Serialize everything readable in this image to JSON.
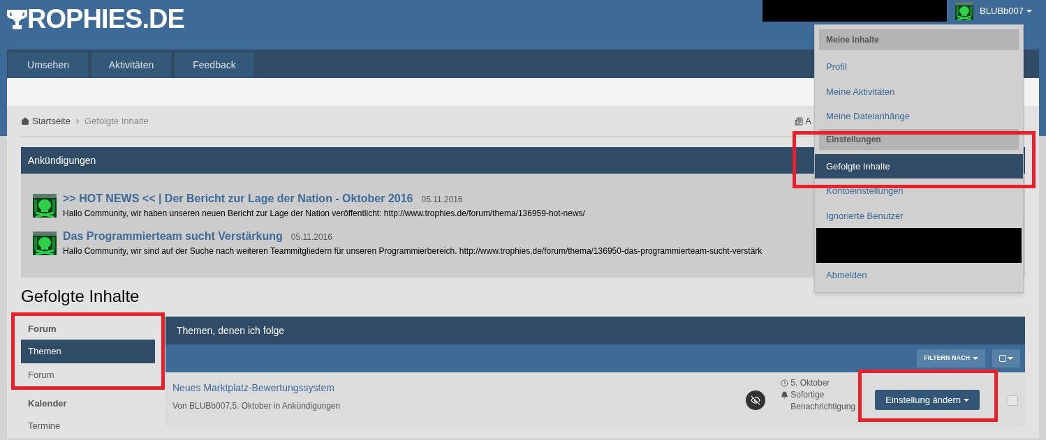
{
  "header": {
    "logo": "ROPHIES.DE",
    "user": {
      "name": "BLUBb007"
    }
  },
  "nav": {
    "tabs": [
      {
        "label": "Umsehen"
      },
      {
        "label": "Aktivitäten"
      },
      {
        "label": "Feedback"
      }
    ]
  },
  "breadcrumb": {
    "items": [
      "Startseite",
      "Gefolgte Inhalte"
    ],
    "side_link": "A"
  },
  "announcements": {
    "title": "Ankündigungen",
    "items": [
      {
        "title": ">> HOT NEWS << | Der Bericht zur Lage der Nation - Oktober 2016",
        "date": "05.11.2016",
        "text": "Hallo Community, wir haben unseren neuen Bericht zur Lage der Nation veröffentlicht: http://www.trophies.de/forum/thema/136959-hot-news/"
      },
      {
        "title": "Das Programmierteam sucht Verstärkung",
        "date": "05.11.2016",
        "text": "Hallo Community, wir sind auf der Suche nach weiteren Teammitgliedern für unseren Programmierbereich. http://www.trophies.de/forum/thema/136950-das-programmierteam-sucht-verstärk"
      }
    ]
  },
  "page_title": "Gefolgte Inhalte",
  "sidebar": {
    "groups": [
      {
        "title": "Forum",
        "highlighted": true,
        "items": [
          {
            "label": "Themen",
            "selected": true
          },
          {
            "label": "Forum",
            "selected": false
          }
        ]
      },
      {
        "title": "Kalender",
        "highlighted": false,
        "items": [
          {
            "label": "Termine",
            "selected": false
          }
        ]
      }
    ]
  },
  "topics": {
    "title": "Themen, denen ich folge",
    "filter_button": "FILTERN NACH",
    "rows": [
      {
        "title": "Neues Marktplatz-Bewertungssystem",
        "meta": "Von BLUBb007,5. Oktober in Ankündigungen",
        "date": "5. Oktober",
        "notification": "Sofortige Benachrichtigung",
        "button": "Einstellung ändern",
        "button_highlighted": true,
        "checked": false
      }
    ]
  },
  "user_menu": {
    "sections": [
      {
        "title": "Meine Inhalte",
        "items": [
          {
            "kind": "link",
            "label": "Profil",
            "selected": false,
            "highlighted": false
          },
          {
            "kind": "link",
            "label": "Meine Aktivitäten",
            "selected": false,
            "highlighted": false
          },
          {
            "kind": "link",
            "label": "Meine Dateianhänge",
            "selected": false,
            "highlighted": false
          }
        ]
      },
      {
        "title": "Einstellungen",
        "items": [
          {
            "kind": "link",
            "label": "Gefolgte Inhalte",
            "selected": true,
            "highlighted": true
          },
          {
            "kind": "link",
            "label": "Kontoeinstellungen",
            "selected": false,
            "highlighted": false
          },
          {
            "kind": "link",
            "label": "Ignorierte Benutzer",
            "selected": false,
            "highlighted": false
          },
          {
            "kind": "redacted"
          },
          {
            "kind": "link",
            "label": "Abmelden",
            "selected": false,
            "highlighted": false
          }
        ]
      }
    ]
  }
}
